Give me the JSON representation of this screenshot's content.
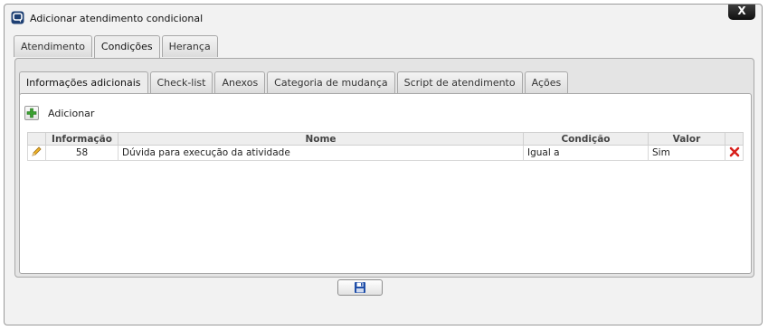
{
  "dialog": {
    "title": "Adicionar atendimento condicional",
    "close_label": "X"
  },
  "outer_tabs": [
    {
      "label": "Atendimento",
      "active": false
    },
    {
      "label": "Condições",
      "active": true
    },
    {
      "label": "Herança",
      "active": false
    }
  ],
  "inner_tabs": [
    {
      "label": "Informações adicionais",
      "active": true
    },
    {
      "label": "Check-list",
      "active": false
    },
    {
      "label": "Anexos",
      "active": false
    },
    {
      "label": "Categoria de mudança",
      "active": false
    },
    {
      "label": "Script de atendimento",
      "active": false
    },
    {
      "label": "Ações",
      "active": false
    }
  ],
  "toolbar": {
    "add_label": "Adicionar",
    "add_icon": "plus-icon"
  },
  "table": {
    "columns": [
      "",
      "Informação",
      "Nome",
      "Condição",
      "Valor",
      ""
    ],
    "rows": [
      {
        "edit_icon": "pencil-icon",
        "informacao": "58",
        "nome": "Dúvida para execução da atividade",
        "condicao": "Igual a",
        "valor": "Sim",
        "delete_icon": "delete-x-icon"
      }
    ]
  },
  "footer": {
    "save_icon": "floppy-disk-icon"
  },
  "colors": {
    "delete_red": "#d8201c",
    "add_green": "#3aa030",
    "save_blue": "#1f4ea8",
    "title_icon_blue": "#1d3f73"
  }
}
